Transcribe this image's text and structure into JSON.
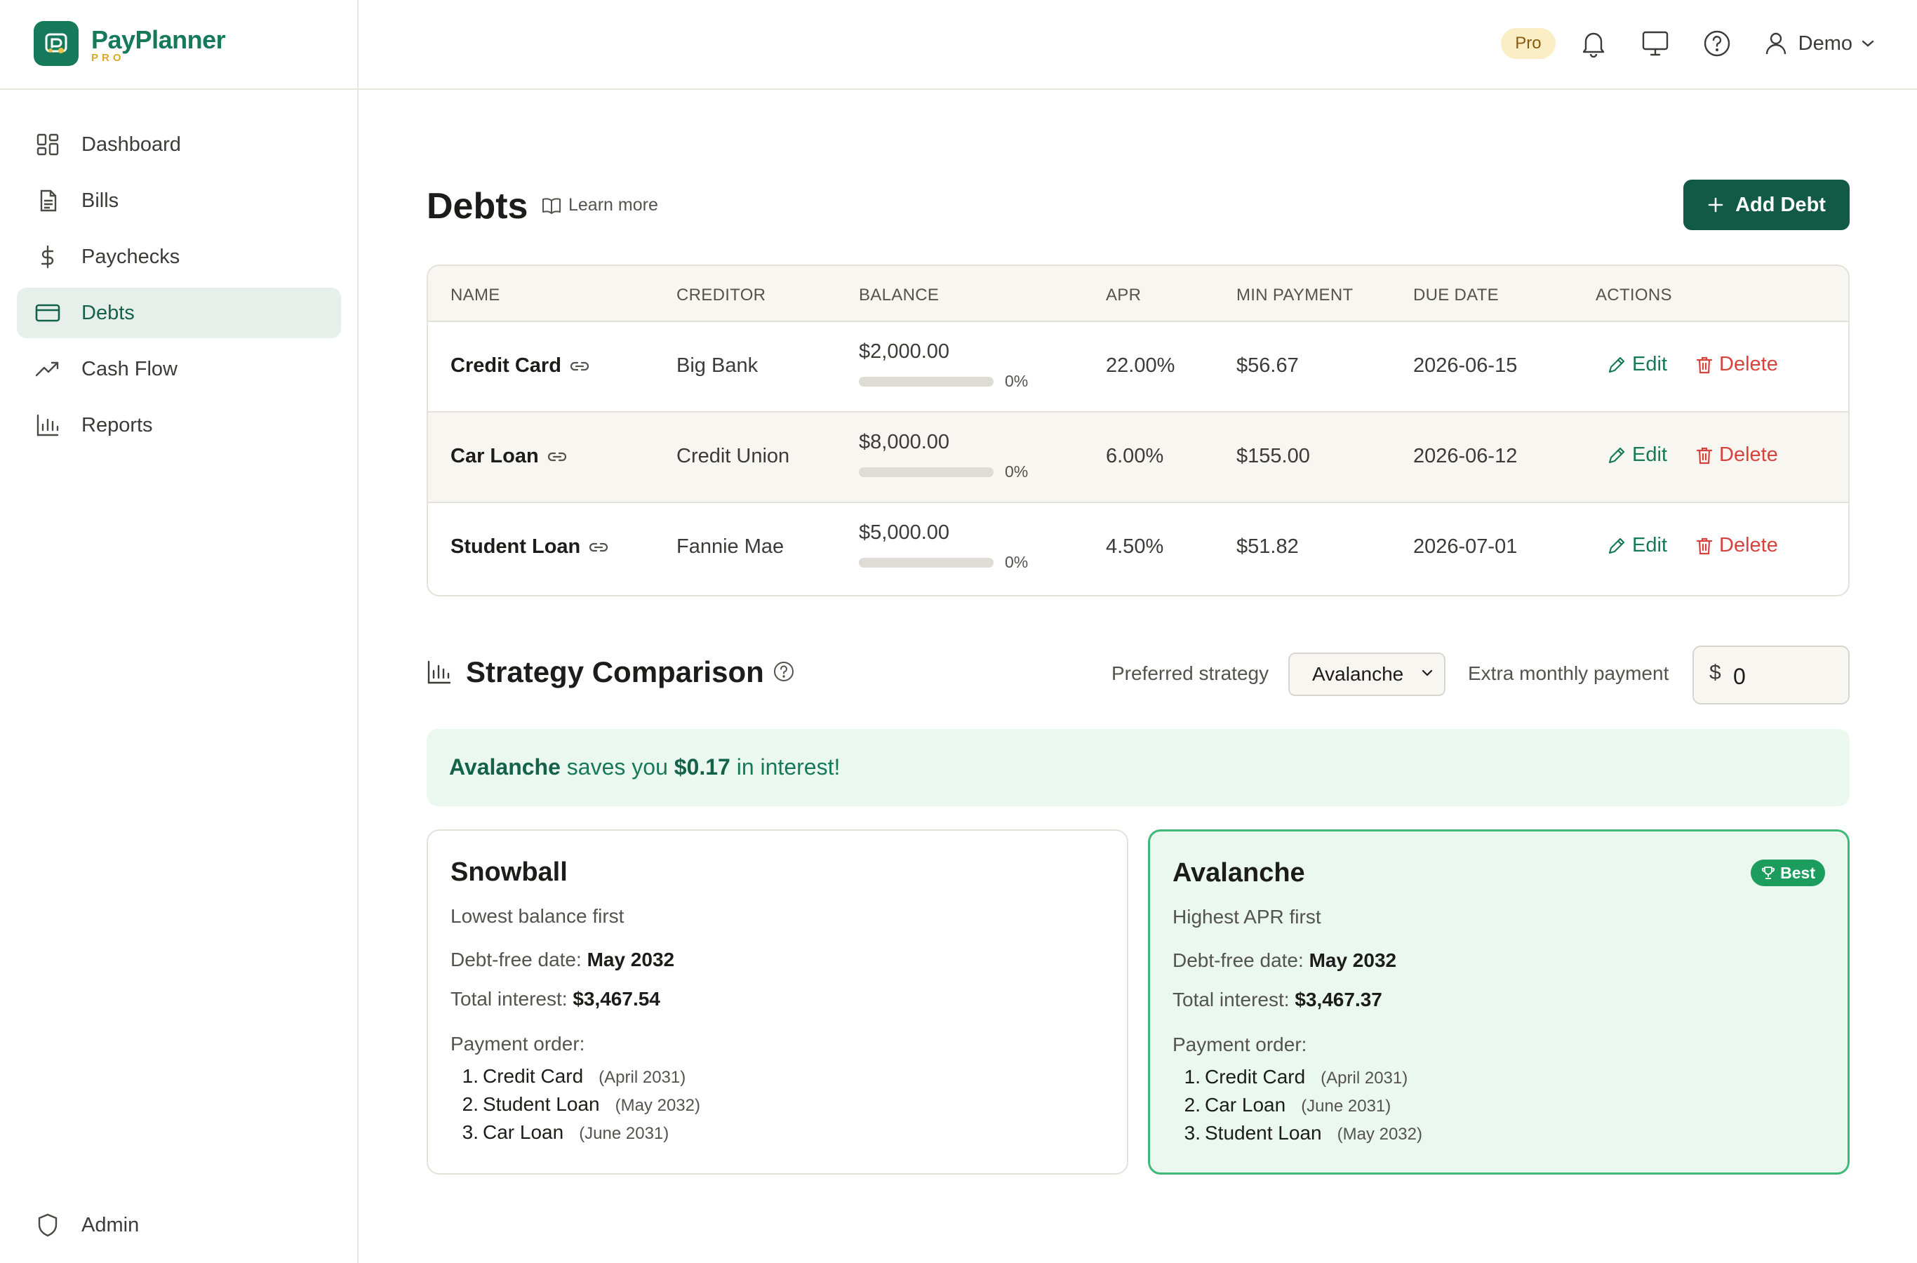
{
  "brand": {
    "name": "PayPlanner",
    "tier": "PRO"
  },
  "nav": {
    "items": [
      {
        "label": "Dashboard",
        "icon": "dashboard-icon"
      },
      {
        "label": "Bills",
        "icon": "document-icon"
      },
      {
        "label": "Paychecks",
        "icon": "dollar-icon"
      },
      {
        "label": "Debts",
        "icon": "credit-card-icon",
        "active": true
      },
      {
        "label": "Cash Flow",
        "icon": "trending-up-icon"
      },
      {
        "label": "Reports",
        "icon": "bar-chart-icon"
      }
    ],
    "admin": "Admin"
  },
  "topbar": {
    "pro_badge": "Pro",
    "user": "Demo"
  },
  "page": {
    "title": "Debts",
    "learn_more": "Learn more",
    "add_button": "Add Debt"
  },
  "table": {
    "headers": [
      "NAME",
      "CREDITOR",
      "BALANCE",
      "APR",
      "MIN PAYMENT",
      "DUE DATE",
      "ACTIONS"
    ],
    "rows": [
      {
        "name": "Credit Card",
        "creditor": "Big Bank",
        "balance": "$2,000.00",
        "progress": 0,
        "progress_label": "0%",
        "apr": "22.00%",
        "min_payment": "$56.67",
        "due_date": "2026-06-15"
      },
      {
        "name": "Car Loan",
        "creditor": "Credit Union",
        "balance": "$8,000.00",
        "progress": 0,
        "progress_label": "0%",
        "apr": "6.00%",
        "min_payment": "$155.00",
        "due_date": "2026-06-12"
      },
      {
        "name": "Student Loan",
        "creditor": "Fannie Mae",
        "balance": "$5,000.00",
        "progress": 0,
        "progress_label": "0%",
        "apr": "4.50%",
        "min_payment": "$51.82",
        "due_date": "2026-07-01"
      }
    ],
    "edit_label": "Edit",
    "delete_label": "Delete"
  },
  "strategy": {
    "title": "Strategy Comparison",
    "preferred_label": "Preferred strategy",
    "preferred_value": "Avalanche",
    "extra_label": "Extra monthly payment",
    "extra_currency": "$",
    "extra_value": "0",
    "savings": {
      "strategy": "Avalanche",
      "pre": "saves you",
      "amount": "$0.17",
      "post": "in interest!"
    },
    "debt_free_label": "Debt-free date:",
    "interest_label": "Total interest:",
    "order_label": "Payment order:",
    "cards": [
      {
        "title": "Snowball",
        "subtitle": "Lowest balance first",
        "debt_free": "May 2032",
        "total_interest": "$3,467.54",
        "order": [
          {
            "num": "1.",
            "name": "Credit Card",
            "when": "(April 2031)"
          },
          {
            "num": "2.",
            "name": "Student Loan",
            "when": "(May 2032)"
          },
          {
            "num": "3.",
            "name": "Car Loan",
            "when": "(June 2031)"
          }
        ]
      },
      {
        "title": "Avalanche",
        "subtitle": "Highest APR first",
        "badge": "Best",
        "debt_free": "May 2032",
        "total_interest": "$3,467.37",
        "order": [
          {
            "num": "1.",
            "name": "Credit Card",
            "when": "(April 2031)"
          },
          {
            "num": "2.",
            "name": "Car Loan",
            "when": "(June 2031)"
          },
          {
            "num": "3.",
            "name": "Student Loan",
            "when": "(May 2032)"
          }
        ]
      }
    ]
  },
  "colors": {
    "brand": "#16795a",
    "dark_green": "#125a45",
    "danger": "#d8423c",
    "pro_gold": "#d8a92a"
  }
}
